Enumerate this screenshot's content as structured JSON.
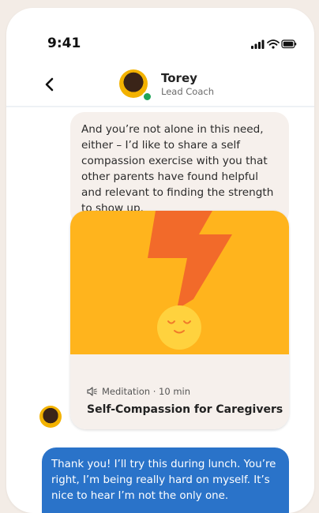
{
  "status_bar": {
    "time": "9:41"
  },
  "header": {
    "coach_name": "Torey",
    "coach_role": "Lead Coach"
  },
  "messages": {
    "coach_text": "And you’re not alone in this need, either – I’d like to share a self compassion exercise with you that other parents have found helpful and relevant to finding the strength to show up.",
    "user_text": "Thank you! I’ll try this during lunch. You’re right, I’m being really hard on myself. It’s nice to hear I’m not the only one."
  },
  "meditation_card": {
    "meta": "Meditation · 10 min",
    "title": "Self-Compassion for Caregivers"
  },
  "colors": {
    "card_art_bg": "#ffb41d",
    "bolt": "#f26a2a",
    "sun": "#ffd23e",
    "user_bubble": "#2a73c9",
    "coach_bubble": "#f6f0ec"
  },
  "icons": [
    "signal-icon",
    "wifi-icon",
    "battery-icon",
    "back-chevron-icon",
    "speaker-icon"
  ]
}
